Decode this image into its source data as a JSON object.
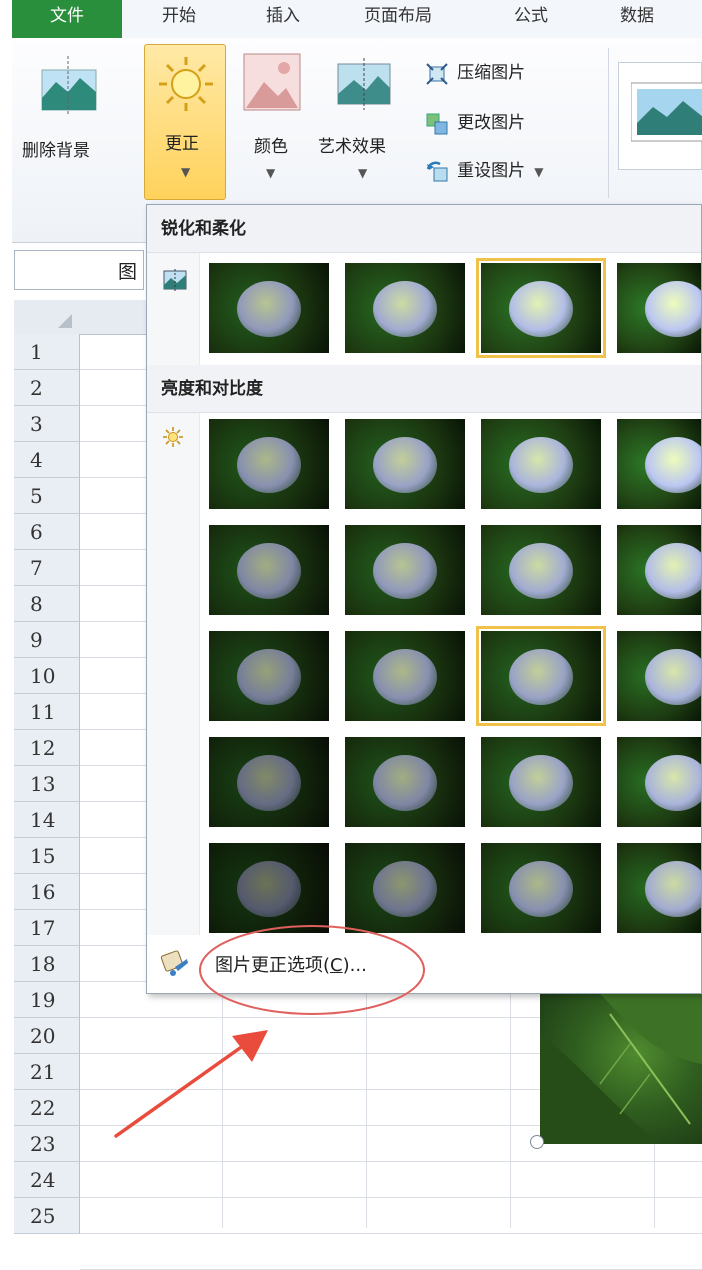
{
  "tabs": [
    "文件",
    "开始",
    "插入",
    "页面布局",
    "公式",
    "数据"
  ],
  "ribbon": {
    "remove_bg": "删除背景",
    "corrections": "更正",
    "color": "颜色",
    "artistic": "艺术效果",
    "compress": "压缩图片",
    "change": "更改图片",
    "reset": "重设图片"
  },
  "namebox_value": "图",
  "rows": [
    "1",
    "2",
    "3",
    "4",
    "5",
    "6",
    "7",
    "8",
    "9",
    "10",
    "11",
    "12",
    "13",
    "14",
    "15",
    "16",
    "17",
    "18",
    "19",
    "20",
    "21",
    "22",
    "23",
    "24",
    "25"
  ],
  "dropdown": {
    "section_sharpen": "锐化和柔化",
    "section_brightness": "亮度和对比度",
    "options_text": "图片更正选项(",
    "options_key": "C",
    "options_suffix": ")..."
  },
  "colors": {
    "file_tab": "#2a8f3c",
    "selection": "#f0c24c",
    "annotation": "#e0605e",
    "arrow": "#e94b3c"
  },
  "icons": [
    "landscape-icon",
    "sun-icon",
    "color-icon",
    "artistic-icon",
    "compress-icon",
    "change-icon",
    "reset-icon",
    "sharpen-icon",
    "brightness-icon",
    "paint-icon"
  ]
}
